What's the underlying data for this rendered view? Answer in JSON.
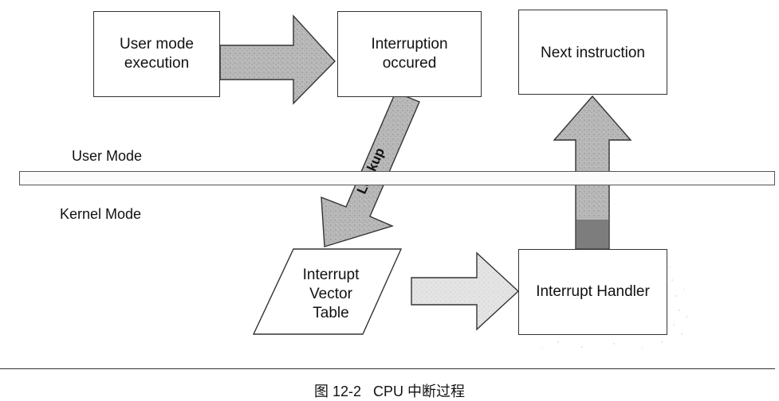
{
  "nodes": {
    "user_mode_execution": "User mode\nexecution",
    "interruption_occured": "Interruption\noccured",
    "next_instruction": "Next instruction",
    "interrupt_vector_table": "Interrupt\nVector\nTable",
    "interrupt_handler": "Interrupt Handler"
  },
  "regions": {
    "user_mode": "User Mode",
    "kernel_mode": "Kernel Mode"
  },
  "arrows": {
    "lookup": "Lookup"
  },
  "caption": "图 12-2   CPU 中断过程",
  "colors": {
    "arrow_fill": "#b3b3b3",
    "arrow_dark": "#7d7d7d",
    "stroke": "#333333"
  }
}
